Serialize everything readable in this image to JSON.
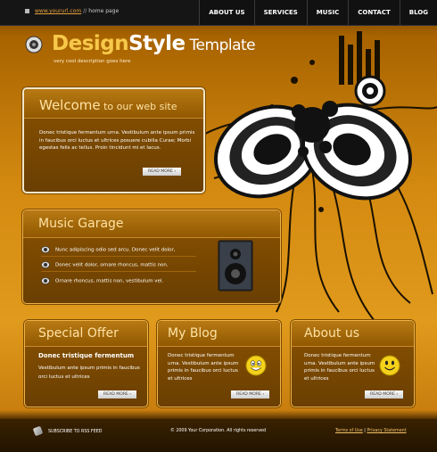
{
  "topbar": {
    "breadcrumb_url": "www.yoururl.com",
    "breadcrumb_sep": "//",
    "breadcrumb_home": "home page"
  },
  "nav": [
    "ABOUT US",
    "SERVICES",
    "MUSIC",
    "CONTACT",
    "BLOG"
  ],
  "header": {
    "logo_design": "Design",
    "logo_style": "Style",
    "logo_template": " Template",
    "tagline": "very cool description goes here"
  },
  "welcome": {
    "title_main": "Welcome",
    "title_rest": " to our web site",
    "text": "Donec tristique fermentum urna. Vestibulum ante ipsum primis in faucibus orci luctus et ultrices posuere cubilia Curae; Morbi egestas felis ac tellus. Proin tincidunt mi et lacus.",
    "button": "READ MORE"
  },
  "music": {
    "title": "Music Garage",
    "items": [
      "Nunc adipiscing odio sed arcu. Donec velit dolor,",
      "Donec velit dolor, ornare rhoncus, mattis non.",
      "Ornare rhoncus, mattis non, vestibulum vel."
    ]
  },
  "special": {
    "title": "Special Offer",
    "headline": "Donec tristique fermentum",
    "text": "Vestibulum ante ipsum primis in faucibus orci luctus et ultrices",
    "button": "READ MORE"
  },
  "blog": {
    "title": "My Blog",
    "text": "Donec tristique fermentum urna. Vestibulum ante ipsum primis in faucibus orci luctus et ultrices",
    "button": "READ MORE"
  },
  "about": {
    "title": "About us",
    "text": "Donec tristique fermentum urna. Vestibulum ante ipsum primis in faucibus orci luctus et ultrices",
    "button": "READ MORE"
  },
  "footer": {
    "rss": "SUBSCRIBE TO RSS FEED",
    "copyright": "© 2009 Your Corporation. All rights reserved",
    "terms": "Terms of Use",
    "sep": "|",
    "privacy": "Privacy Statement"
  },
  "colors": {
    "accent": "#f7c84a",
    "panel": "#7a4800",
    "background": "#e09a1c",
    "topbar": "#151515"
  },
  "icons": [
    "speaker-logo-icon",
    "smiley-icon",
    "rss-icon",
    "speaker-bullet-icon"
  ]
}
